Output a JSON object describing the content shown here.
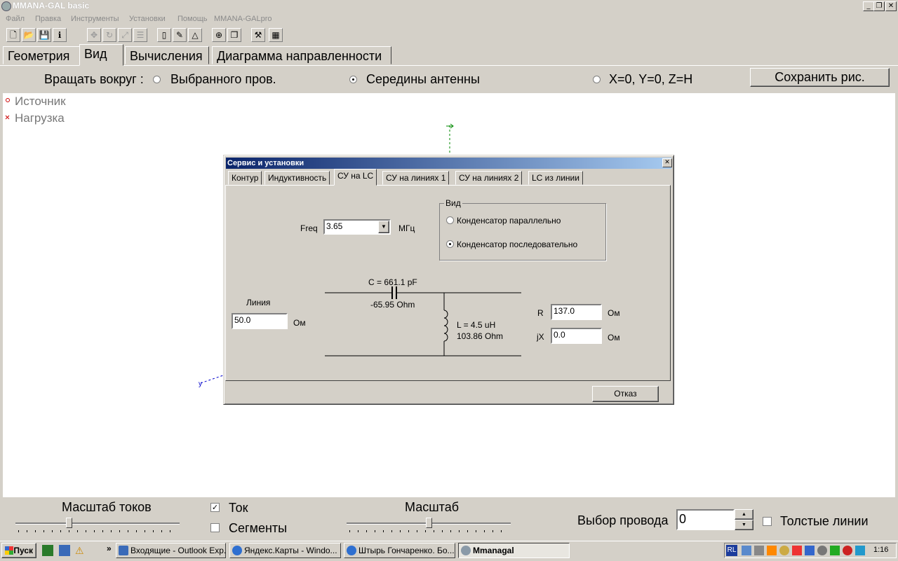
{
  "window": {
    "title": "MMANA-GAL basic"
  },
  "menu": [
    "Файл",
    "Правка",
    "Инструменты",
    "Установки",
    "Помощь",
    "MMANA-GALpro"
  ],
  "tabs": [
    "Геометрия",
    "Вид",
    "Вычисления",
    "Диаграмма направленности"
  ],
  "rotate": {
    "label": "Вращать вокруг :",
    "options": [
      "Выбранного пров.",
      "Середины антенны",
      "X=0, Y=0, Z=H"
    ],
    "selected": "Середины антенны",
    "save_button": "Сохранить рис."
  },
  "legend": {
    "source": "Источник",
    "load": "Нагрузка"
  },
  "dialog": {
    "title": "Сервис и установки",
    "tabs": [
      "Контур",
      "Индуктивность",
      "СУ на LC",
      "СУ на линиях 1",
      "СУ на линиях 2",
      "LC из линии"
    ],
    "active_tab": "СУ на LC",
    "freq_label": "Freq",
    "freq_value": "3.65",
    "freq_unit": "МГц",
    "view_group": "Вид",
    "view_options": [
      "Конденсатор параллельно",
      "Конденсатор последовательно"
    ],
    "view_selected": "Конденсатор последовательно",
    "line_label": "Линия",
    "line_value": "50.0",
    "line_unit": "Ом",
    "cap_label": "C = 661.1 pF",
    "cap_reactance": "-65.95 Ohm",
    "ind_label": "L = 4.5 uH",
    "ind_reactance": "103.86 Ohm",
    "r_label": "R",
    "r_value": "137.0",
    "r_unit": "Ом",
    "jx_label": "jX",
    "jx_value": "0.0",
    "jx_unit": "Ом",
    "cancel_button": "Отказ"
  },
  "bottom": {
    "current_scale_label": "Масштаб токов",
    "current_scale_level": 0.32,
    "current_label": "Ток",
    "current_checked": true,
    "segments_label": "Сегменты",
    "segments_checked": false,
    "scale_label": "Масштаб",
    "scale_level": 0.5,
    "wire_select_label": "Выбор провода",
    "wire_select_value": "0",
    "thick_lines_label": "Толстые линии",
    "thick_lines_checked": false
  },
  "taskbar": {
    "start_label": "Пуск",
    "tasks": [
      "Входящие - Outlook Exp...",
      "Яндекс.Карты - Windo...",
      "Штырь Гончаренко. Бо...",
      "Mmanagal"
    ],
    "active_task": "Mmanagal",
    "tray_lang": "RL",
    "clock": "1:16"
  }
}
